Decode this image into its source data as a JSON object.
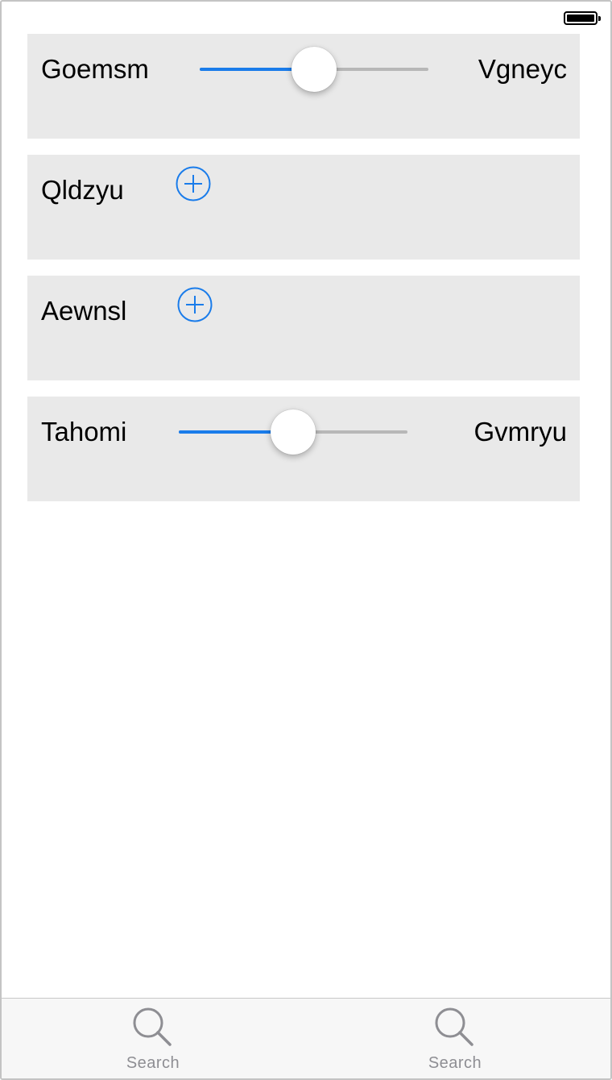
{
  "colors": {
    "accent": "#1a7cea",
    "card_background": "#e9e9e9",
    "track_inactive": "#b7b7b7",
    "tab_label": "#8e8e93"
  },
  "status_bar": {
    "battery_icon": "battery-full-icon"
  },
  "rows": [
    {
      "type": "slider",
      "left_label": "Goemsm",
      "right_label": "Vgneyc",
      "value": 0.5
    },
    {
      "type": "add",
      "label": "Qldzyu",
      "icon": "plus-circle-icon"
    },
    {
      "type": "add",
      "label": "Aewnsl",
      "icon": "plus-circle-icon"
    },
    {
      "type": "slider",
      "left_label": "Tahomi",
      "right_label": "Gvmryu",
      "value": 0.5
    }
  ],
  "tab_bar": {
    "items": [
      {
        "label": "Search",
        "icon": "search-icon"
      },
      {
        "label": "Search",
        "icon": "search-icon"
      }
    ]
  }
}
